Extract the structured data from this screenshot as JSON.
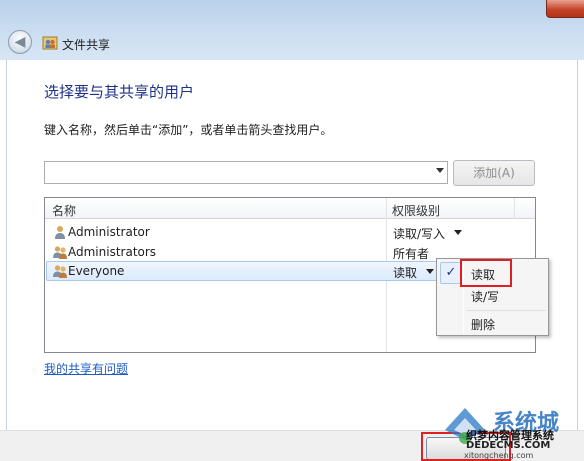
{
  "window": {
    "title": "文件共享"
  },
  "page": {
    "heading": "选择要与其共享的用户",
    "instruction": "键入名称，然后单击“添加”，或者单击箭头查找用户。",
    "add_button": "添加(A)"
  },
  "list": {
    "columns": [
      "名称",
      "权限级别"
    ],
    "rows": [
      {
        "name": "Administrator",
        "permission": "读取/写入",
        "icon": "user-icon"
      },
      {
        "name": "Administrators",
        "permission": "所有者",
        "icon": "group-icon"
      },
      {
        "name": "Everyone",
        "permission": "读取",
        "icon": "group-icon",
        "selected": true
      }
    ]
  },
  "context_menu": {
    "items": [
      "读取",
      "读/写",
      "删除"
    ],
    "checked": "读取"
  },
  "links": {
    "problem": "我的共享有问题"
  },
  "watermark": {
    "brand": "系统城",
    "line1": "织梦内容管理系统",
    "line2": "DEDECMS.COM",
    "line3": "xitongcheng.com"
  },
  "colors": {
    "heading": "#1e3287",
    "link": "#1c5bc7",
    "highlight": "#e02020"
  }
}
